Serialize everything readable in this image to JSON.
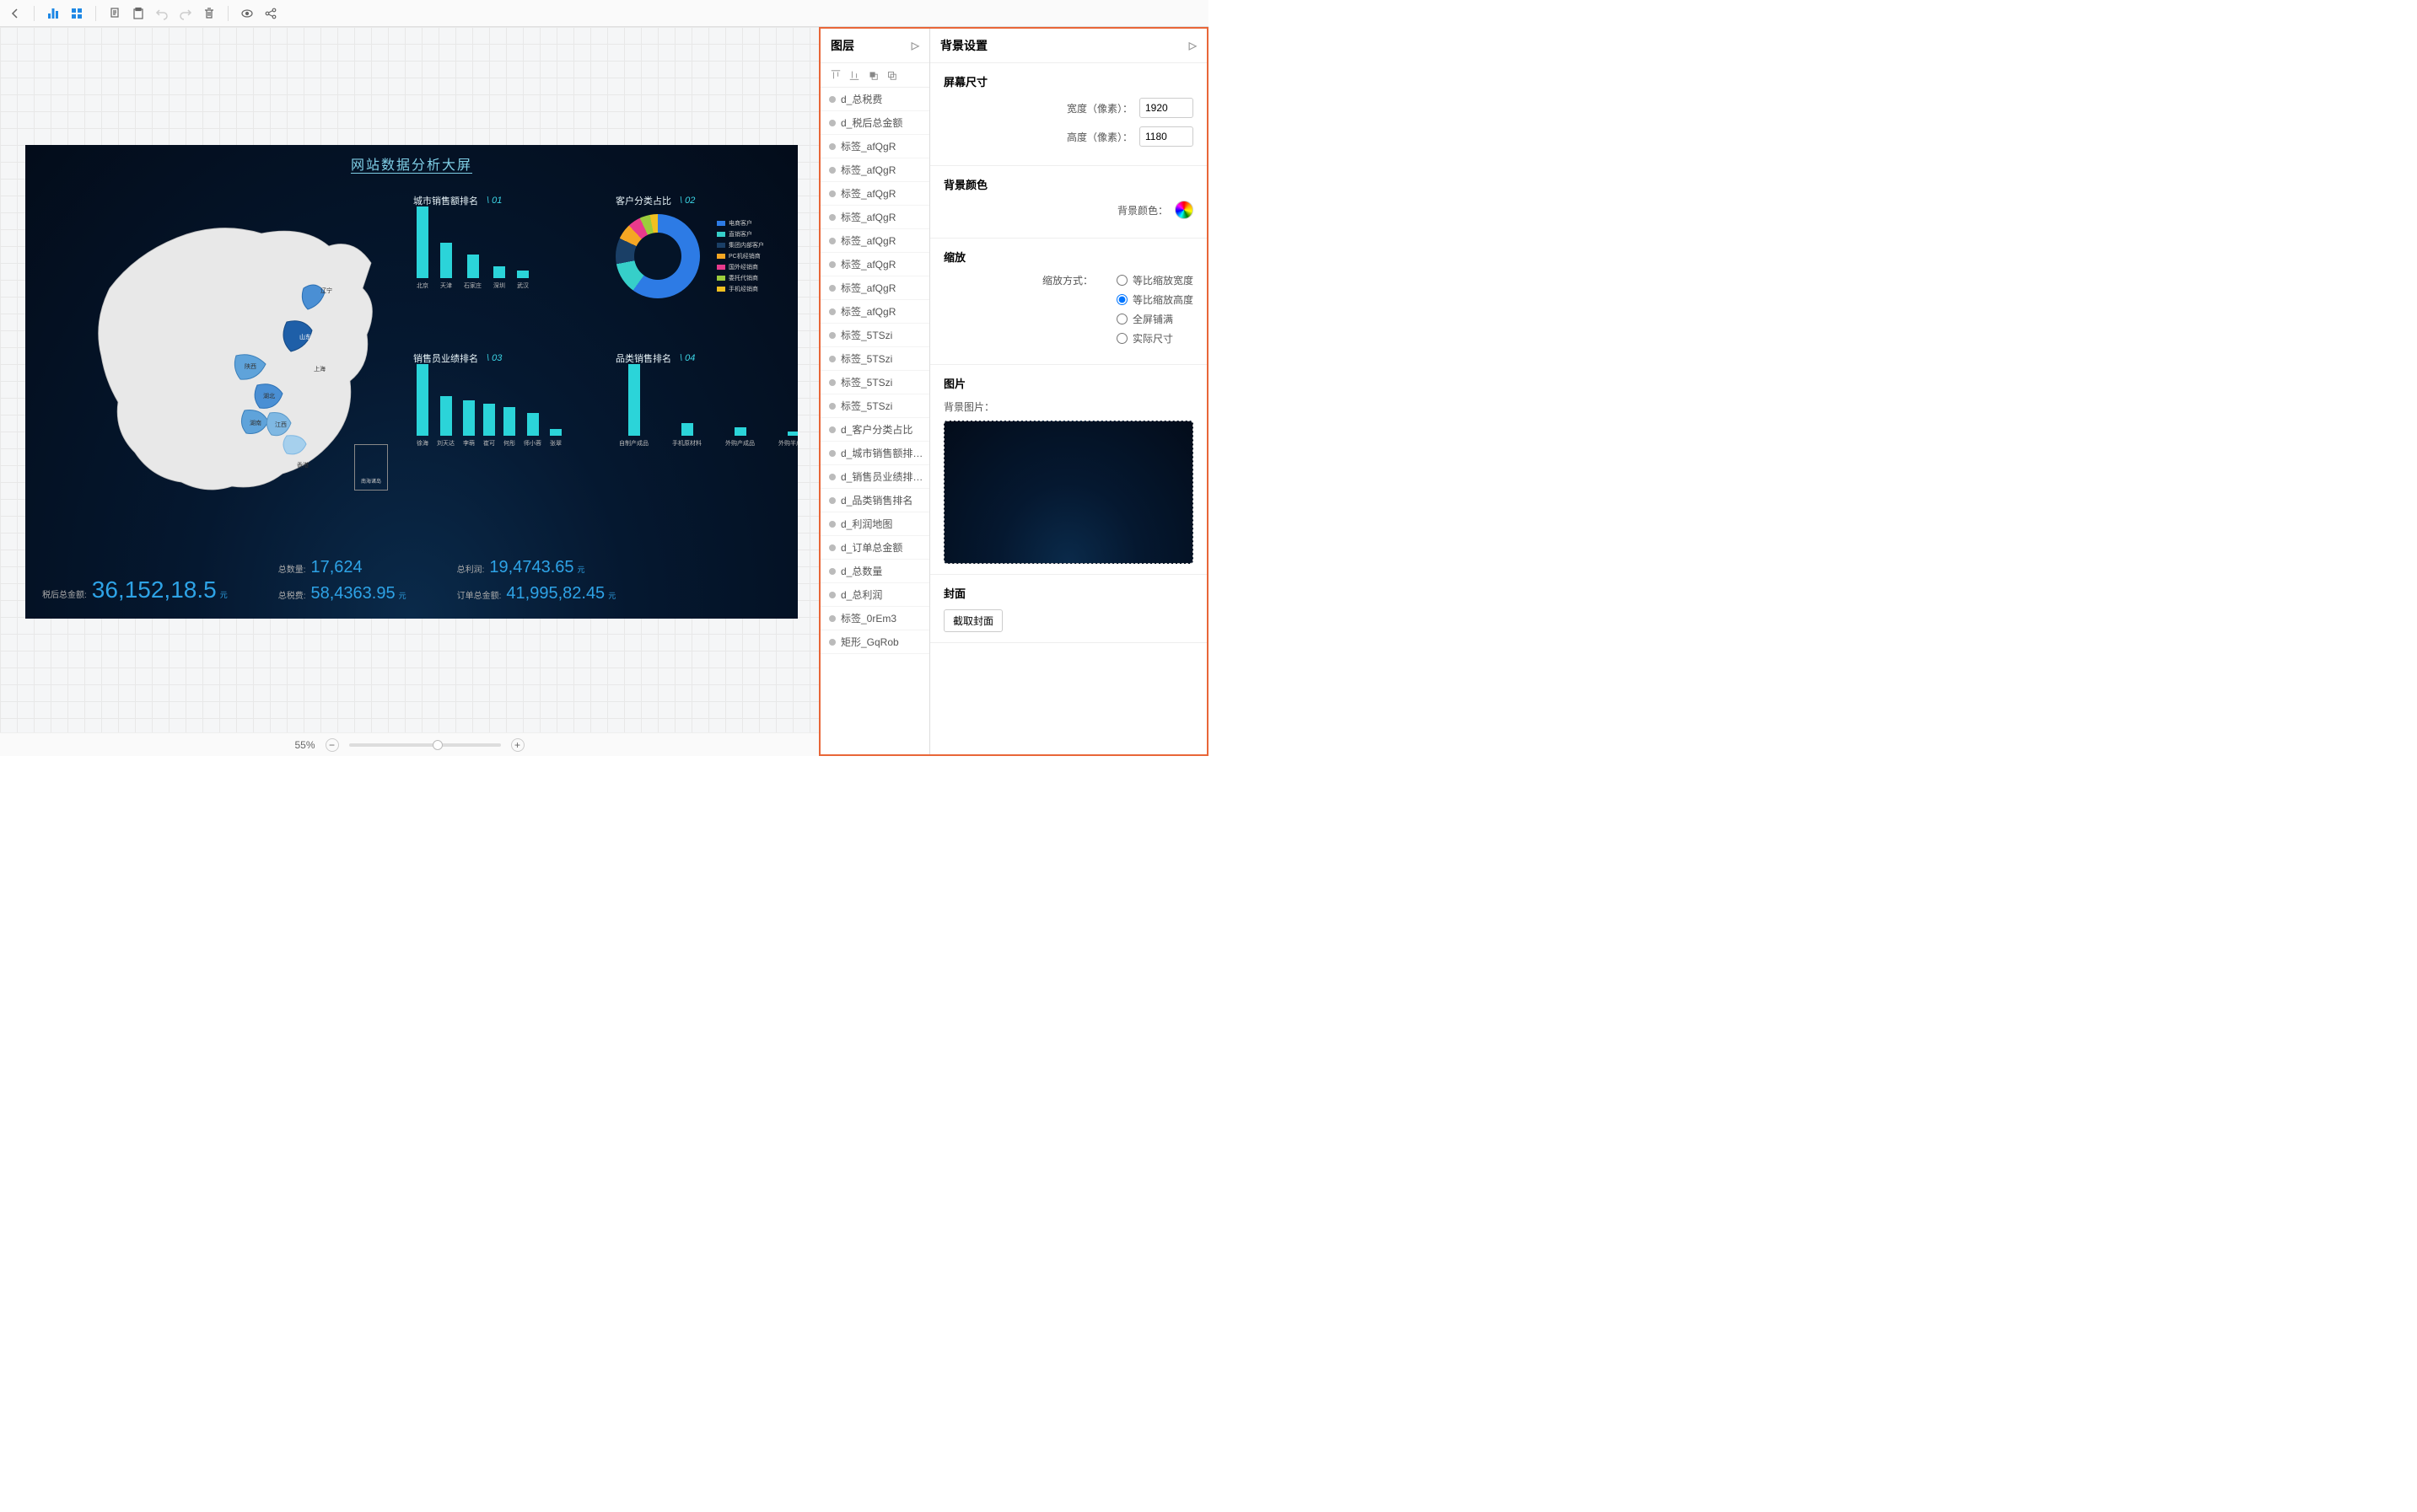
{
  "toolbar": {
    "back": "返回"
  },
  "dashboard": {
    "title": "网站数据分析大屏",
    "map_inset": "南海诸岛",
    "chart1": {
      "label": "城市销售额排名",
      "num": "\\ 01"
    },
    "chart2": {
      "label": "客户分类占比",
      "num": "\\ 02"
    },
    "chart3": {
      "label": "销售员业绩排名",
      "num": "\\ 03"
    },
    "chart4": {
      "label": "品类销售排名",
      "num": "\\ 04"
    },
    "map_labels": {
      "liaoning": "辽宁",
      "shandong": "山东",
      "shanxi": "陕西",
      "hubei": "湖北",
      "hunan": "湖南",
      "jiangxi": "江西",
      "shanghai": "上海",
      "hongkong": "香港"
    },
    "legend2": [
      {
        "color": "#2d7be5",
        "label": "电商客户"
      },
      {
        "color": "#36cfc9",
        "label": "直销客户"
      },
      {
        "color": "#1a3f66",
        "label": "集团内部客户"
      },
      {
        "color": "#f5a623",
        "label": "PC机经销商"
      },
      {
        "color": "#e83a8c",
        "label": "国外经销商"
      },
      {
        "color": "#9ccc3c",
        "label": "委托代销商"
      },
      {
        "color": "#f0c020",
        "label": "手机经销商"
      }
    ],
    "metrics": [
      {
        "label": "税后总金额:",
        "value": "36,152,18.5",
        "unit": "元"
      },
      {
        "label": "总数量:",
        "value": "17,624",
        "unit": ""
      },
      {
        "label": "总税费:",
        "value": "58,4363.95",
        "unit": "元"
      },
      {
        "label": "总利润:",
        "value": "19,4743.65",
        "unit": "元"
      },
      {
        "label": "订单总金额:",
        "value": "41,995,82.45",
        "unit": "元"
      }
    ]
  },
  "chart_data": [
    {
      "type": "bar",
      "title": "城市销售额排名",
      "categories": [
        "北京",
        "天津",
        "石家庄",
        "深圳",
        "武汉"
      ],
      "values": [
        90,
        45,
        30,
        15,
        10
      ]
    },
    {
      "type": "pie",
      "title": "客户分类占比",
      "labels": [
        "电商客户",
        "直销客户",
        "集团内部客户",
        "PC机经销商",
        "国外经销商",
        "委托代销商",
        "手机经销商"
      ],
      "values": [
        60,
        12,
        10,
        6,
        5,
        4,
        3
      ],
      "colors": [
        "#2d7be5",
        "#36cfc9",
        "#1a3f66",
        "#f5a623",
        "#e83a8c",
        "#9ccc3c",
        "#f0c020"
      ]
    },
    {
      "type": "bar",
      "title": "销售员业绩排名",
      "categories": [
        "徐海",
        "刘天达",
        "李萌",
        "崔可",
        "何彤",
        "师小蓉",
        "张翠"
      ],
      "values": [
        100,
        55,
        50,
        45,
        40,
        32,
        10
      ]
    },
    {
      "type": "bar",
      "title": "品类销售排名",
      "categories": [
        "自制产成品",
        "手机原材料",
        "外购产成品",
        "外购半成品"
      ],
      "values": [
        100,
        18,
        12,
        6
      ]
    }
  ],
  "zoom": {
    "value": "55%",
    "pos": 55
  },
  "layers": {
    "title": "图层",
    "items": [
      "d_总税费",
      "d_税后总金额",
      "标签_afQgR",
      "标签_afQgR",
      "标签_afQgR",
      "标签_afQgR",
      "标签_afQgR",
      "标签_afQgR",
      "标签_afQgR",
      "标签_afQgR",
      "标签_5TSzi",
      "标签_5TSzi",
      "标签_5TSzi",
      "标签_5TSzi",
      "d_客户分类占比",
      "d_城市销售额排…",
      "d_销售员业绩排…",
      "d_品类销售排名",
      "d_利润地图",
      "d_订单总金额",
      "d_总数量",
      "d_总利润",
      "标签_0rEm3",
      "矩形_GqRob"
    ]
  },
  "props": {
    "title": "背景设置",
    "screen": {
      "title": "屏幕尺寸",
      "width_label": "宽度（像素）：",
      "width": "1920",
      "height_label": "高度（像素）：",
      "height": "1180"
    },
    "bgcolor": {
      "title": "背景颜色",
      "label": "背景颜色："
    },
    "zoom": {
      "title": "缩放",
      "mode_label": "缩放方式：",
      "opts": [
        "等比缩放宽度",
        "等比缩放高度",
        "全屏铺满",
        "实际尺寸"
      ],
      "selected": 1
    },
    "image": {
      "title": "图片",
      "label": "背景图片："
    },
    "cover": {
      "title": "封面",
      "btn": "截取封面"
    }
  }
}
